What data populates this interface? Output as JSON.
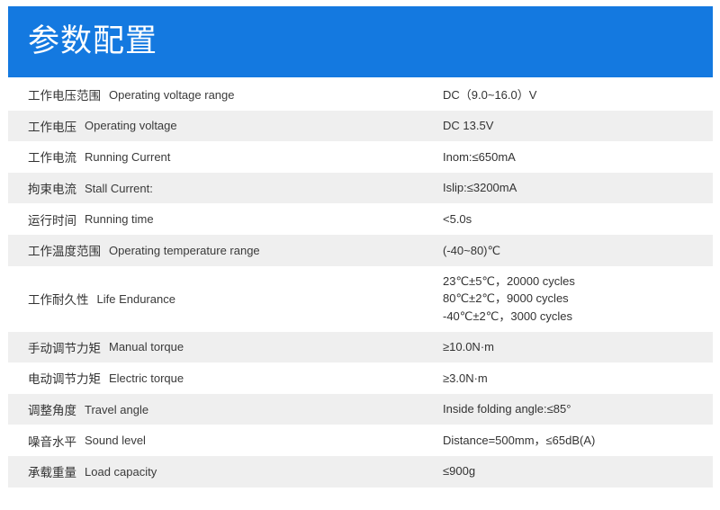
{
  "header": {
    "title": "参数配置",
    "background_color": "#1479e0"
  },
  "rows": [
    {
      "cn": "工作电压范围",
      "en": "Operating voltage range",
      "values": [
        "DC（9.0~16.0）V"
      ]
    },
    {
      "cn": "工作电压",
      "en": "Operating voltage",
      "values": [
        "DC 13.5V"
      ]
    },
    {
      "cn": "工作电流",
      "en": "Running Current",
      "values": [
        "Inom:≤650mA"
      ]
    },
    {
      "cn": "拘束电流",
      "en": "Stall Current:",
      "values": [
        "Islip:≤3200mA"
      ]
    },
    {
      "cn": "运行时间",
      "en": "Running time",
      "values": [
        "<5.0s"
      ]
    },
    {
      "cn": "工作温度范围",
      "en": "Operating temperature range",
      "values": [
        "(-40~80)℃"
      ]
    },
    {
      "cn": "工作耐久性",
      "en": "Life Endurance",
      "values": [
        "23℃±5℃，20000 cycles",
        "80℃±2℃，9000 cycles",
        "-40℃±2℃，3000 cycles"
      ]
    },
    {
      "cn": "手动调节力矩",
      "en": "Manual torque",
      "values": [
        "≥10.0N·m"
      ]
    },
    {
      "cn": "电动调节力矩",
      "en": "Electric torque",
      "values": [
        "≥3.0N·m"
      ]
    },
    {
      "cn": "调整角度",
      "en": "Travel angle",
      "values": [
        "Inside folding angle:≤85°"
      ]
    },
    {
      "cn": "噪音水平",
      "en": "Sound level",
      "values": [
        "Distance=500mm，≤65dB(A)"
      ]
    },
    {
      "cn": "承载重量",
      "en": "Load capacity",
      "values": [
        "≤900g"
      ]
    }
  ]
}
